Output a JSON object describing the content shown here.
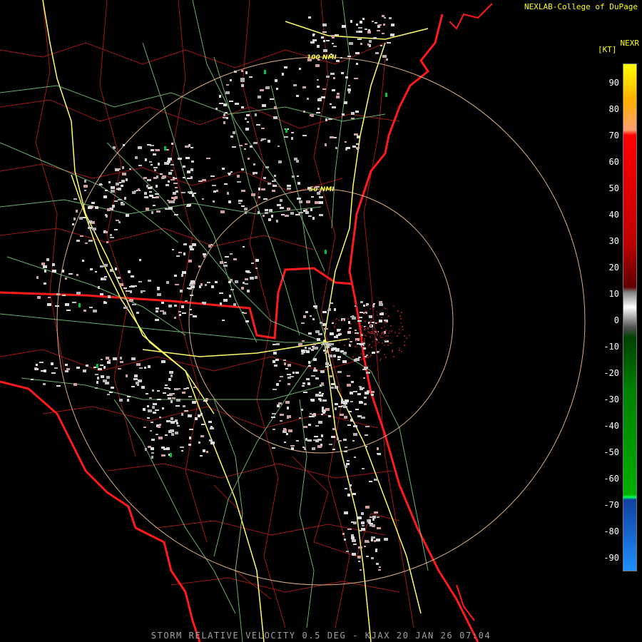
{
  "header": {
    "credit": "NEXLAB-College of DuPage",
    "product_code": "NEXR",
    "unit": "[KT]"
  },
  "footer": {
    "caption": "STORM RELATIVE VELOCITY 0.5 DEG - KJAX 20 JAN 26 07:04"
  },
  "range_rings": {
    "inner_label": "50 NMI",
    "outer_label": "100 NMI"
  },
  "legend": {
    "ticks": [
      "90",
      "80",
      "70",
      "60",
      "50",
      "40",
      "30",
      "20",
      "10",
      "0",
      "-10",
      "-20",
      "-30",
      "-40",
      "-50",
      "-60",
      "-70",
      "-80",
      "-90"
    ],
    "colors": {
      "max_inbound": "#ffff00",
      "strong_outbound": "#ff0000",
      "near_zero": "#ffffff",
      "moderate_toward": "#00b000",
      "strong_toward": "#1e90ff"
    }
  },
  "map_colors": {
    "county_lines": "#a01818",
    "state_lines": "#ff1a1a",
    "coastline": "#ff1a1a",
    "highways": "#ffff66",
    "roads": "#7fcf7f",
    "range_rings": "#ffcc99",
    "radar_echo": "#c8c8c8"
  }
}
